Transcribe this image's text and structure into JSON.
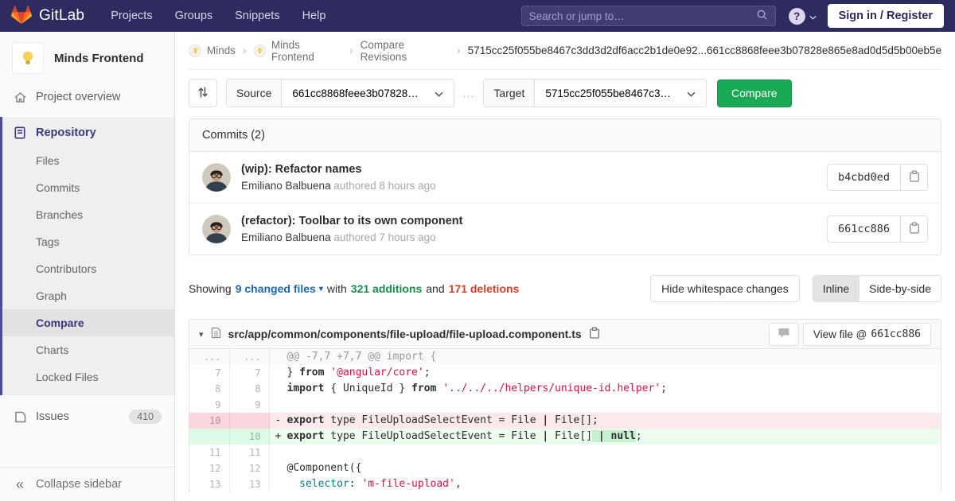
{
  "colors": {
    "navbar_bg": "#2e2b5f",
    "sidebar_accent": "#4f4c96",
    "active_indigo": "#393880",
    "button_green": "#1aaa55",
    "link_blue": "#1b69b6",
    "additions_green": "#168f48",
    "deletions_red": "#db3b21",
    "diff_del_bg": "#fbe9eb",
    "diff_add_bg": "#ecfdf0",
    "string_red": "#dd1144",
    "attr_teal": "#008080"
  },
  "icons": {
    "logo": "gitlab-tanuki-icon",
    "search": "search-icon",
    "help": "question-icon",
    "swap": "swap-arrows-icon",
    "copy": "clipboard-copy-icon",
    "comment": "comment-bubble-icon",
    "project_avatar": "lightbulb-icon"
  },
  "navbar": {
    "brand": "GitLab",
    "menu": [
      "Projects",
      "Groups",
      "Snippets",
      "Help"
    ],
    "search_placeholder": "Search or jump to…",
    "signin_label": "Sign in / Register"
  },
  "sidebar": {
    "project_name": "Minds Frontend",
    "overview_label": "Project overview",
    "repository_label": "Repository",
    "repo_items": [
      "Files",
      "Commits",
      "Branches",
      "Tags",
      "Contributors",
      "Graph",
      "Compare",
      "Charts",
      "Locked Files"
    ],
    "active_item": "Compare",
    "issues_label": "Issues",
    "issues_count": "410",
    "collapse_label": "Collapse sidebar"
  },
  "breadcrumb": {
    "items": [
      {
        "label": "Minds",
        "avatar": true
      },
      {
        "label": "Minds Frontend",
        "avatar": true
      },
      {
        "label": "Compare Revisions",
        "avatar": false
      }
    ],
    "current": "5715cc25f055be8467c3dd3d2df6acc2b1de0e92...661cc8868feee3b07828e865e8ad0d5d5b00eb5e"
  },
  "compare_form": {
    "source_label": "Source",
    "source_value": "661cc8868feee3b07828…",
    "separator": "...",
    "target_label": "Target",
    "target_value": "5715cc25f055be8467c3…",
    "compare_button": "Compare"
  },
  "commits": {
    "header": "Commits (2)",
    "items": [
      {
        "title": "(wip): Refactor names",
        "author": "Emiliano Balbuena",
        "meta": "authored 8 hours ago",
        "sha": "b4cbd0ed"
      },
      {
        "title": "(refactor): Toolbar to its own component",
        "author": "Emiliano Balbuena",
        "meta": "authored 7 hours ago",
        "sha": "661cc886"
      }
    ]
  },
  "diff_summary": {
    "showing": "Showing",
    "files_link": "9 changed files",
    "with": "with",
    "additions": "321 additions",
    "and": "and",
    "deletions": "171 deletions",
    "hide_whitespace": "Hide whitespace changes",
    "inline": "Inline",
    "side_by_side": "Side-by-side"
  },
  "diff_file": {
    "path": "src/app/common/components/file-upload/file-upload.component.ts",
    "view_file_label": "View file @",
    "view_sha": "661cc886",
    "lines": [
      {
        "type": "match",
        "old": "...",
        "new": "...",
        "segs": [
          [
            "@@ -7,7 +7,7 @@ import {",
            ""
          ]
        ]
      },
      {
        "type": "context",
        "old": "7",
        "new": "7",
        "segs": [
          [
            "} ",
            ""
          ],
          [
            "from",
            "k"
          ],
          [
            " ",
            ""
          ],
          [
            "'@angular/core'",
            "s"
          ],
          [
            ";",
            ""
          ]
        ]
      },
      {
        "type": "context",
        "old": "8",
        "new": "8",
        "segs": [
          [
            "import",
            "k"
          ],
          [
            " { UniqueId } ",
            ""
          ],
          [
            "from",
            "k"
          ],
          [
            " ",
            ""
          ],
          [
            "'../../../helpers/unique-id.helper'",
            "s"
          ],
          [
            ";",
            ""
          ]
        ]
      },
      {
        "type": "context",
        "old": "9",
        "new": "9",
        "segs": []
      },
      {
        "type": "del",
        "old": "10",
        "new": "",
        "sign": "-",
        "segs": [
          [
            "export",
            "k"
          ],
          [
            " type FileUploadSelectEvent = File ",
            ""
          ],
          [
            "|",
            "k"
          ],
          [
            " File[];",
            ""
          ]
        ]
      },
      {
        "type": "add",
        "old": "",
        "new": "10",
        "sign": "+",
        "segs": [
          [
            "export",
            "k"
          ],
          [
            " type FileUploadSelectEvent = File ",
            ""
          ],
          [
            "|",
            "k"
          ],
          [
            " File[]",
            ""
          ],
          [
            " ",
            "hl"
          ],
          [
            "|",
            "hl k"
          ],
          [
            " ",
            "hl"
          ],
          [
            "null",
            "hl k"
          ],
          [
            ";",
            ""
          ]
        ]
      },
      {
        "type": "context",
        "old": "11",
        "new": "11",
        "segs": []
      },
      {
        "type": "context",
        "old": "12",
        "new": "12",
        "segs": [
          [
            "@Component({",
            ""
          ]
        ]
      },
      {
        "type": "context",
        "old": "13",
        "new": "13",
        "segs": [
          [
            "  ",
            ""
          ],
          [
            "selector",
            "na"
          ],
          [
            ": ",
            ""
          ],
          [
            "'m-file-upload'",
            "s"
          ],
          [
            ",",
            ""
          ]
        ]
      }
    ]
  }
}
